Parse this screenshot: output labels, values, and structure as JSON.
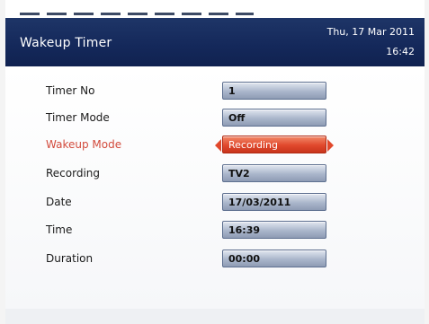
{
  "header": {
    "title": "Wakeup Timer",
    "date": "Thu, 17 Mar 2011",
    "time": "16:42"
  },
  "form": {
    "rows": [
      {
        "label": "Timer No",
        "value": "1"
      },
      {
        "label": "Timer Mode",
        "value": "Off"
      },
      {
        "label": "Wakeup Mode",
        "value": "Recording"
      },
      {
        "label": "Recording",
        "value": "TV2"
      },
      {
        "label": "Date",
        "value": "17/03/2011"
      },
      {
        "label": "Time",
        "value": "16:39"
      },
      {
        "label": "Duration",
        "value": "00:00"
      }
    ]
  },
  "colors": {
    "header": "#14285a",
    "highlight": "#e1482c",
    "active_label": "#d24a3c"
  },
  "icons": {
    "left_arrow": "triangle-left",
    "right_arrow": "triangle-right"
  }
}
